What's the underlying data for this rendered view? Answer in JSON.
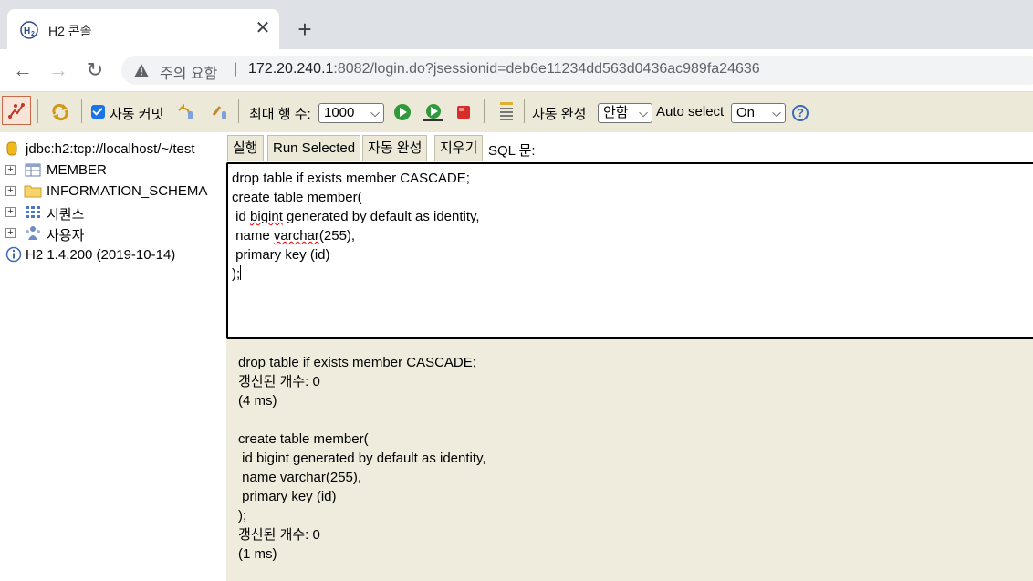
{
  "browser": {
    "tab_title": "H2 콘솔",
    "warning_label": "주의 요함",
    "url_host": "172.20.240.1",
    "url_rest": ":8082/login.do?jsessionid=deb6e11234dd563d0436ac989fa24636"
  },
  "toolbar": {
    "auto_commit_label": "자동 커밋",
    "auto_commit_checked": true,
    "max_rows_label": "최대 행 수:",
    "max_rows_value": "1000",
    "auto_complete_label": "자동 완성",
    "auto_complete_value": "안함",
    "auto_select_label": "Auto select",
    "auto_select_value": "On"
  },
  "tree": {
    "connection": "jdbc:h2:tcp://localhost/~/test",
    "items": [
      {
        "label": "MEMBER",
        "icon": "table-icon"
      },
      {
        "label": "INFORMATION_SCHEMA",
        "icon": "folder-icon"
      },
      {
        "label": "시퀀스",
        "icon": "sequence-icon"
      },
      {
        "label": "사용자",
        "icon": "users-icon"
      }
    ],
    "version": "H2 1.4.200 (2019-10-14)"
  },
  "query": {
    "buttons": [
      "실행",
      "Run Selected",
      "자동 완성",
      "지우기"
    ],
    "sql_label": "SQL 문:",
    "editor_lines": [
      "drop table if exists member CASCADE;",
      "create table member(",
      " id bigint generated by default as identity,",
      " name varchar(255),",
      " primary key (id)",
      ");"
    ]
  },
  "result": {
    "lines": [
      "drop table if exists member CASCADE;",
      "갱신된 개수: 0",
      "(4 ms)",
      "",
      "create table member(",
      " id bigint generated by default as identity,",
      " name varchar(255),",
      " primary key (id)",
      ");",
      "갱신된 개수: 0",
      "(1 ms)"
    ]
  }
}
